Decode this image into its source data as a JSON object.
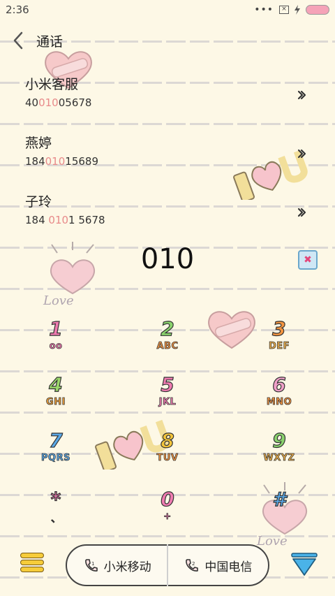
{
  "status_bar": {
    "time": "2:36",
    "signal": "•••"
  },
  "header": {
    "title": "通话"
  },
  "contacts": [
    {
      "name": "小米客服",
      "num_pre": "40",
      "num_hl": "010",
      "num_post": "05678"
    },
    {
      "name": "燕婷",
      "num_pre": "184",
      "num_hl": "010",
      "num_post": "15689"
    },
    {
      "name": "子玲",
      "num_pre": "184 ",
      "num_hl": "010",
      "num_post": "1 5678"
    }
  ],
  "dialer": {
    "input": "010"
  },
  "keypad": [
    {
      "digit": "1",
      "letters": "oo",
      "digit_color": "#ef7bb0",
      "letters_color": "#ef7bb0"
    },
    {
      "digit": "2",
      "letters": "ABC",
      "digit_color": "#8ad36d",
      "letters_color": "#f39440"
    },
    {
      "digit": "3",
      "letters": "DEF",
      "digit_color": "#f39440",
      "letters_color": "#f3b24a"
    },
    {
      "digit": "4",
      "letters": "GHI",
      "digit_color": "#9bd86a",
      "letters_color": "#f3a23a"
    },
    {
      "digit": "5",
      "letters": "JKL",
      "digit_color": "#ef7bb0",
      "letters_color": "#ef7bb0"
    },
    {
      "digit": "6",
      "letters": "MNO",
      "digit_color": "#f0a0c8",
      "letters_color": "#f39440"
    },
    {
      "digit": "7",
      "letters": "PQRS",
      "digit_color": "#5aa9e8",
      "letters_color": "#5aa9e8"
    },
    {
      "digit": "8",
      "letters": "TUV",
      "digit_color": "#f3c43a",
      "letters_color": "#f39440"
    },
    {
      "digit": "9",
      "letters": "WXYZ",
      "digit_color": "#8ad36d",
      "letters_color": "#f3b24a"
    },
    {
      "digit": "*",
      "letters": "、",
      "digit_color": "#ef7bb0",
      "letters_color": "#ef7bb0"
    },
    {
      "digit": "0",
      "letters": "+",
      "digit_color": "#ef7bb0",
      "letters_color": "#ef7bb0"
    },
    {
      "digit": "#",
      "letters": "",
      "digit_color": "#5aa9e8",
      "letters_color": "#5aa9e8"
    }
  ],
  "sim_buttons": [
    {
      "label": "小米移动"
    },
    {
      "label": "中国电信"
    }
  ],
  "decorations": {
    "love_text": "Love"
  },
  "icons": {
    "back": "chevron-left-icon",
    "arrow": "double-chevron-right-icon",
    "delete": "backspace-icon",
    "menu": "menu-icon",
    "collapse": "triangle-down-icon",
    "phone": "phone-icon"
  },
  "colors": {
    "background": "#fdf8e6",
    "highlight": "#e88a8a",
    "menu": "#f6cc3a",
    "collapse": "#4ab3e8"
  }
}
